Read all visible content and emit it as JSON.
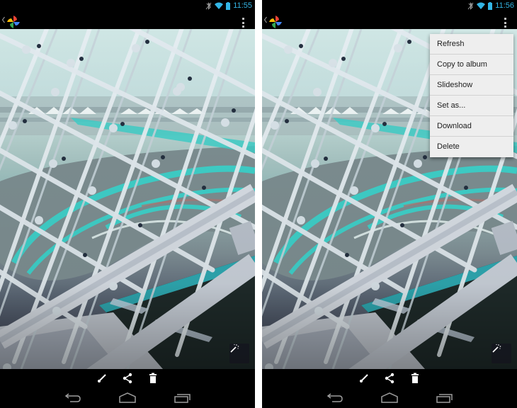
{
  "screens": [
    {
      "id": "left",
      "status_bar": {
        "time": "11:55",
        "icons": [
          "bluetooth-off-icon",
          "wifi-icon",
          "battery-icon"
        ]
      },
      "action_bar": {
        "up_icon": "chevron-left-icon",
        "app_icon": "google-photos-pinwheel-icon",
        "overflow_icon": "overflow-menu-icon"
      },
      "photo": {
        "description": "Glass lattice roof over a racetrack with turquoise-striped track",
        "auto_enhance_icon": "magic-wand-icon"
      },
      "edit_toolbar": {
        "buttons": [
          {
            "icon": "brush-edit-icon"
          },
          {
            "icon": "share-icon"
          },
          {
            "icon": "trash-icon"
          }
        ]
      },
      "nav_bar": {
        "buttons": [
          {
            "icon": "back-icon"
          },
          {
            "icon": "home-icon"
          },
          {
            "icon": "recents-icon"
          }
        ]
      },
      "menu_open": false
    },
    {
      "id": "right",
      "status_bar": {
        "time": "11:56",
        "icons": [
          "bluetooth-off-icon",
          "wifi-icon",
          "battery-icon"
        ]
      },
      "action_bar": {
        "up_icon": "chevron-left-icon",
        "app_icon": "google-photos-pinwheel-icon",
        "overflow_icon": "overflow-menu-icon"
      },
      "photo": {
        "description": "Glass lattice roof over a racetrack with turquoise-striped track",
        "auto_enhance_icon": "magic-wand-icon"
      },
      "edit_toolbar": {
        "buttons": [
          {
            "icon": "brush-edit-icon"
          },
          {
            "icon": "share-icon"
          },
          {
            "icon": "trash-icon"
          }
        ]
      },
      "nav_bar": {
        "buttons": [
          {
            "icon": "back-icon"
          },
          {
            "icon": "home-icon"
          },
          {
            "icon": "recents-icon"
          }
        ]
      },
      "menu_open": true,
      "overflow_menu": {
        "items": [
          {
            "label": "Refresh"
          },
          {
            "label": "Copy to album"
          },
          {
            "label": "Slideshow"
          },
          {
            "label": "Set as..."
          },
          {
            "label": "Download"
          },
          {
            "label": "Delete"
          }
        ]
      }
    }
  ],
  "colors": {
    "status_accent": "#33b5e5",
    "menu_background": "#eeeeee",
    "bar_background": "#000000",
    "track_turquoise": "#3fcfc8"
  }
}
